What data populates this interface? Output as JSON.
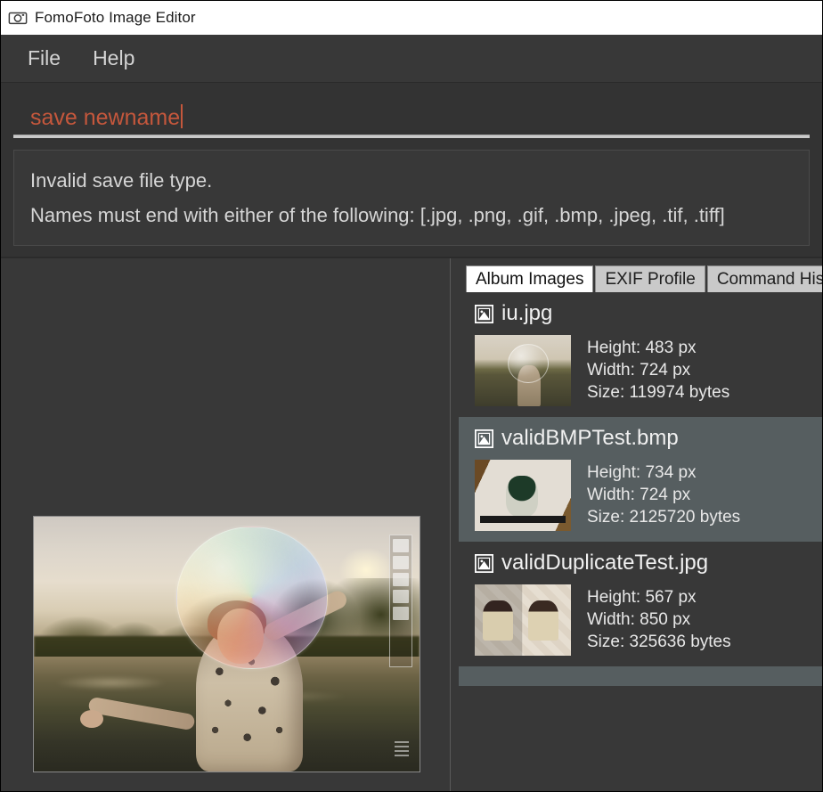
{
  "window": {
    "title": "FomoFoto Image Editor",
    "app_icon": "camera-icon"
  },
  "menubar": {
    "items": [
      {
        "label": "File"
      },
      {
        "label": "Help"
      }
    ]
  },
  "command_input": {
    "value": "save newname",
    "placeholder": "",
    "text_color": "#c4573c",
    "caret_visible": true
  },
  "feedback": {
    "lines": [
      "Invalid save file type.",
      "Names must end with either of the following: [.jpg, .png, .gif, .bmp, .jpeg, .tif, .tiff]"
    ]
  },
  "canvas": {
    "preview_alt": "sunset-lake-bubble-photo"
  },
  "side_panel": {
    "tabs": [
      {
        "label": "Album Images",
        "active": true
      },
      {
        "label": "EXIF Profile",
        "active": false
      },
      {
        "label": "Command History",
        "active": false
      }
    ],
    "album_items": [
      {
        "name": "iu.jpg",
        "icon": "image-file-icon",
        "height": "Height: 483 px",
        "width": "Width: 724 px",
        "size": "Size: 119974 bytes",
        "thumb_class": "t1",
        "highlighted": false
      },
      {
        "name": "validBMPTest.bmp",
        "icon": "image-file-icon",
        "height": "Height: 734 px",
        "width": "Width: 724 px",
        "size": "Size: 2125720 bytes",
        "thumb_class": "t2",
        "highlighted": true
      },
      {
        "name": "validDuplicateTest.jpg",
        "icon": "image-file-icon",
        "height": "Height: 567 px",
        "width": "Width: 850 px",
        "size": "Size: 325636 bytes",
        "thumb_class": "t3",
        "highlighted": false
      }
    ]
  },
  "colors": {
    "window_bg": "#333333",
    "panel_bg": "#383838",
    "highlight_row": "#565e60",
    "command_text": "#c4573c",
    "body_text": "#e8e8e8",
    "tab_active_bg": "#ffffff",
    "tab_inactive_bg": "#c9c9c9"
  }
}
